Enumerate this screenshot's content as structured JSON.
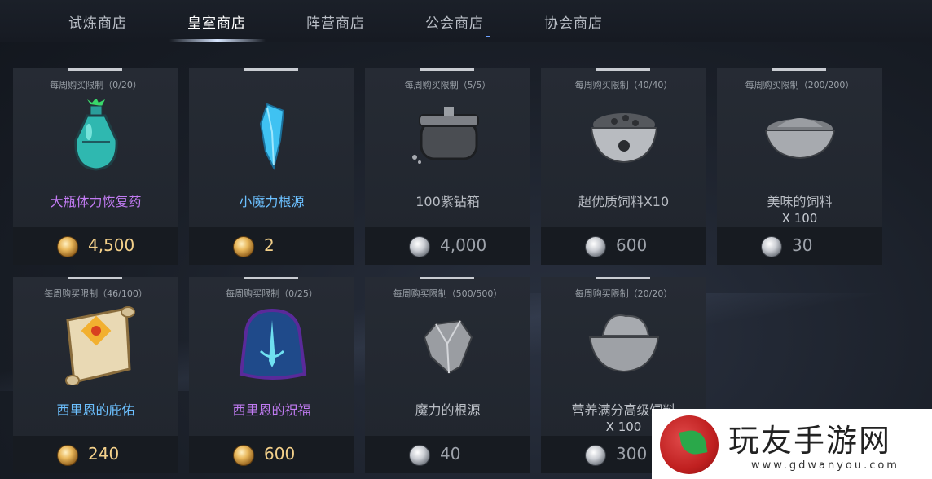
{
  "tabs": [
    {
      "label": "试炼商店",
      "active": false
    },
    {
      "label": "皇室商店",
      "active": true
    },
    {
      "label": "阵营商店",
      "active": false
    },
    {
      "label": "公会商店",
      "active": false
    },
    {
      "label": "协会商店",
      "active": false
    }
  ],
  "items": [
    {
      "limit": "每周购买限制（0/20）",
      "name": "大瓶体力恢复药",
      "qty": "",
      "price": "4,500",
      "currency": "gold",
      "name_color": "purple",
      "icon": "potion-icon"
    },
    {
      "limit": "",
      "name": "小魔力根源",
      "qty": "",
      "price": "2",
      "currency": "gold",
      "name_color": "blue",
      "icon": "crystal-icon"
    },
    {
      "limit": "每周购买限制（5/5）",
      "name": "100紫钻箱",
      "qty": "",
      "price": "4,000",
      "currency": "silver",
      "name_color": "gray",
      "icon": "chest-icon"
    },
    {
      "limit": "每周购买限制（40/40）",
      "name": "超优质饲料X10",
      "qty": "",
      "price": "600",
      "currency": "silver",
      "name_color": "gray",
      "icon": "pet-bowl-icon"
    },
    {
      "limit": "每周购买限制（200/200）",
      "name": "美味的饲料",
      "qty": "X 100",
      "price": "30",
      "currency": "silver",
      "name_color": "gray",
      "icon": "food-bowl-icon"
    },
    {
      "limit": "每周购买限制（46/100）",
      "name": "西里恩的庇佑",
      "qty": "",
      "price": "240",
      "currency": "gold",
      "name_color": "blue",
      "icon": "scroll-icon"
    },
    {
      "limit": "每周购买限制（0/25）",
      "name": "西里恩的祝福",
      "qty": "",
      "price": "600",
      "currency": "gold",
      "name_color": "purple",
      "icon": "rune-stone-icon"
    },
    {
      "limit": "每周购买限制（500/500）",
      "name": "魔力的根源",
      "qty": "",
      "price": "40",
      "currency": "silver",
      "name_color": "gray",
      "icon": "ore-icon"
    },
    {
      "limit": "每周购买限制（20/20）",
      "name": "营养满分高级饲料",
      "qty": "X 100",
      "price": "300",
      "currency": "silver",
      "name_color": "gray",
      "icon": "feed-bowl-icon"
    }
  ],
  "watermark": {
    "cn": "玩友手游网",
    "url": "www.gdwanyou.com"
  }
}
